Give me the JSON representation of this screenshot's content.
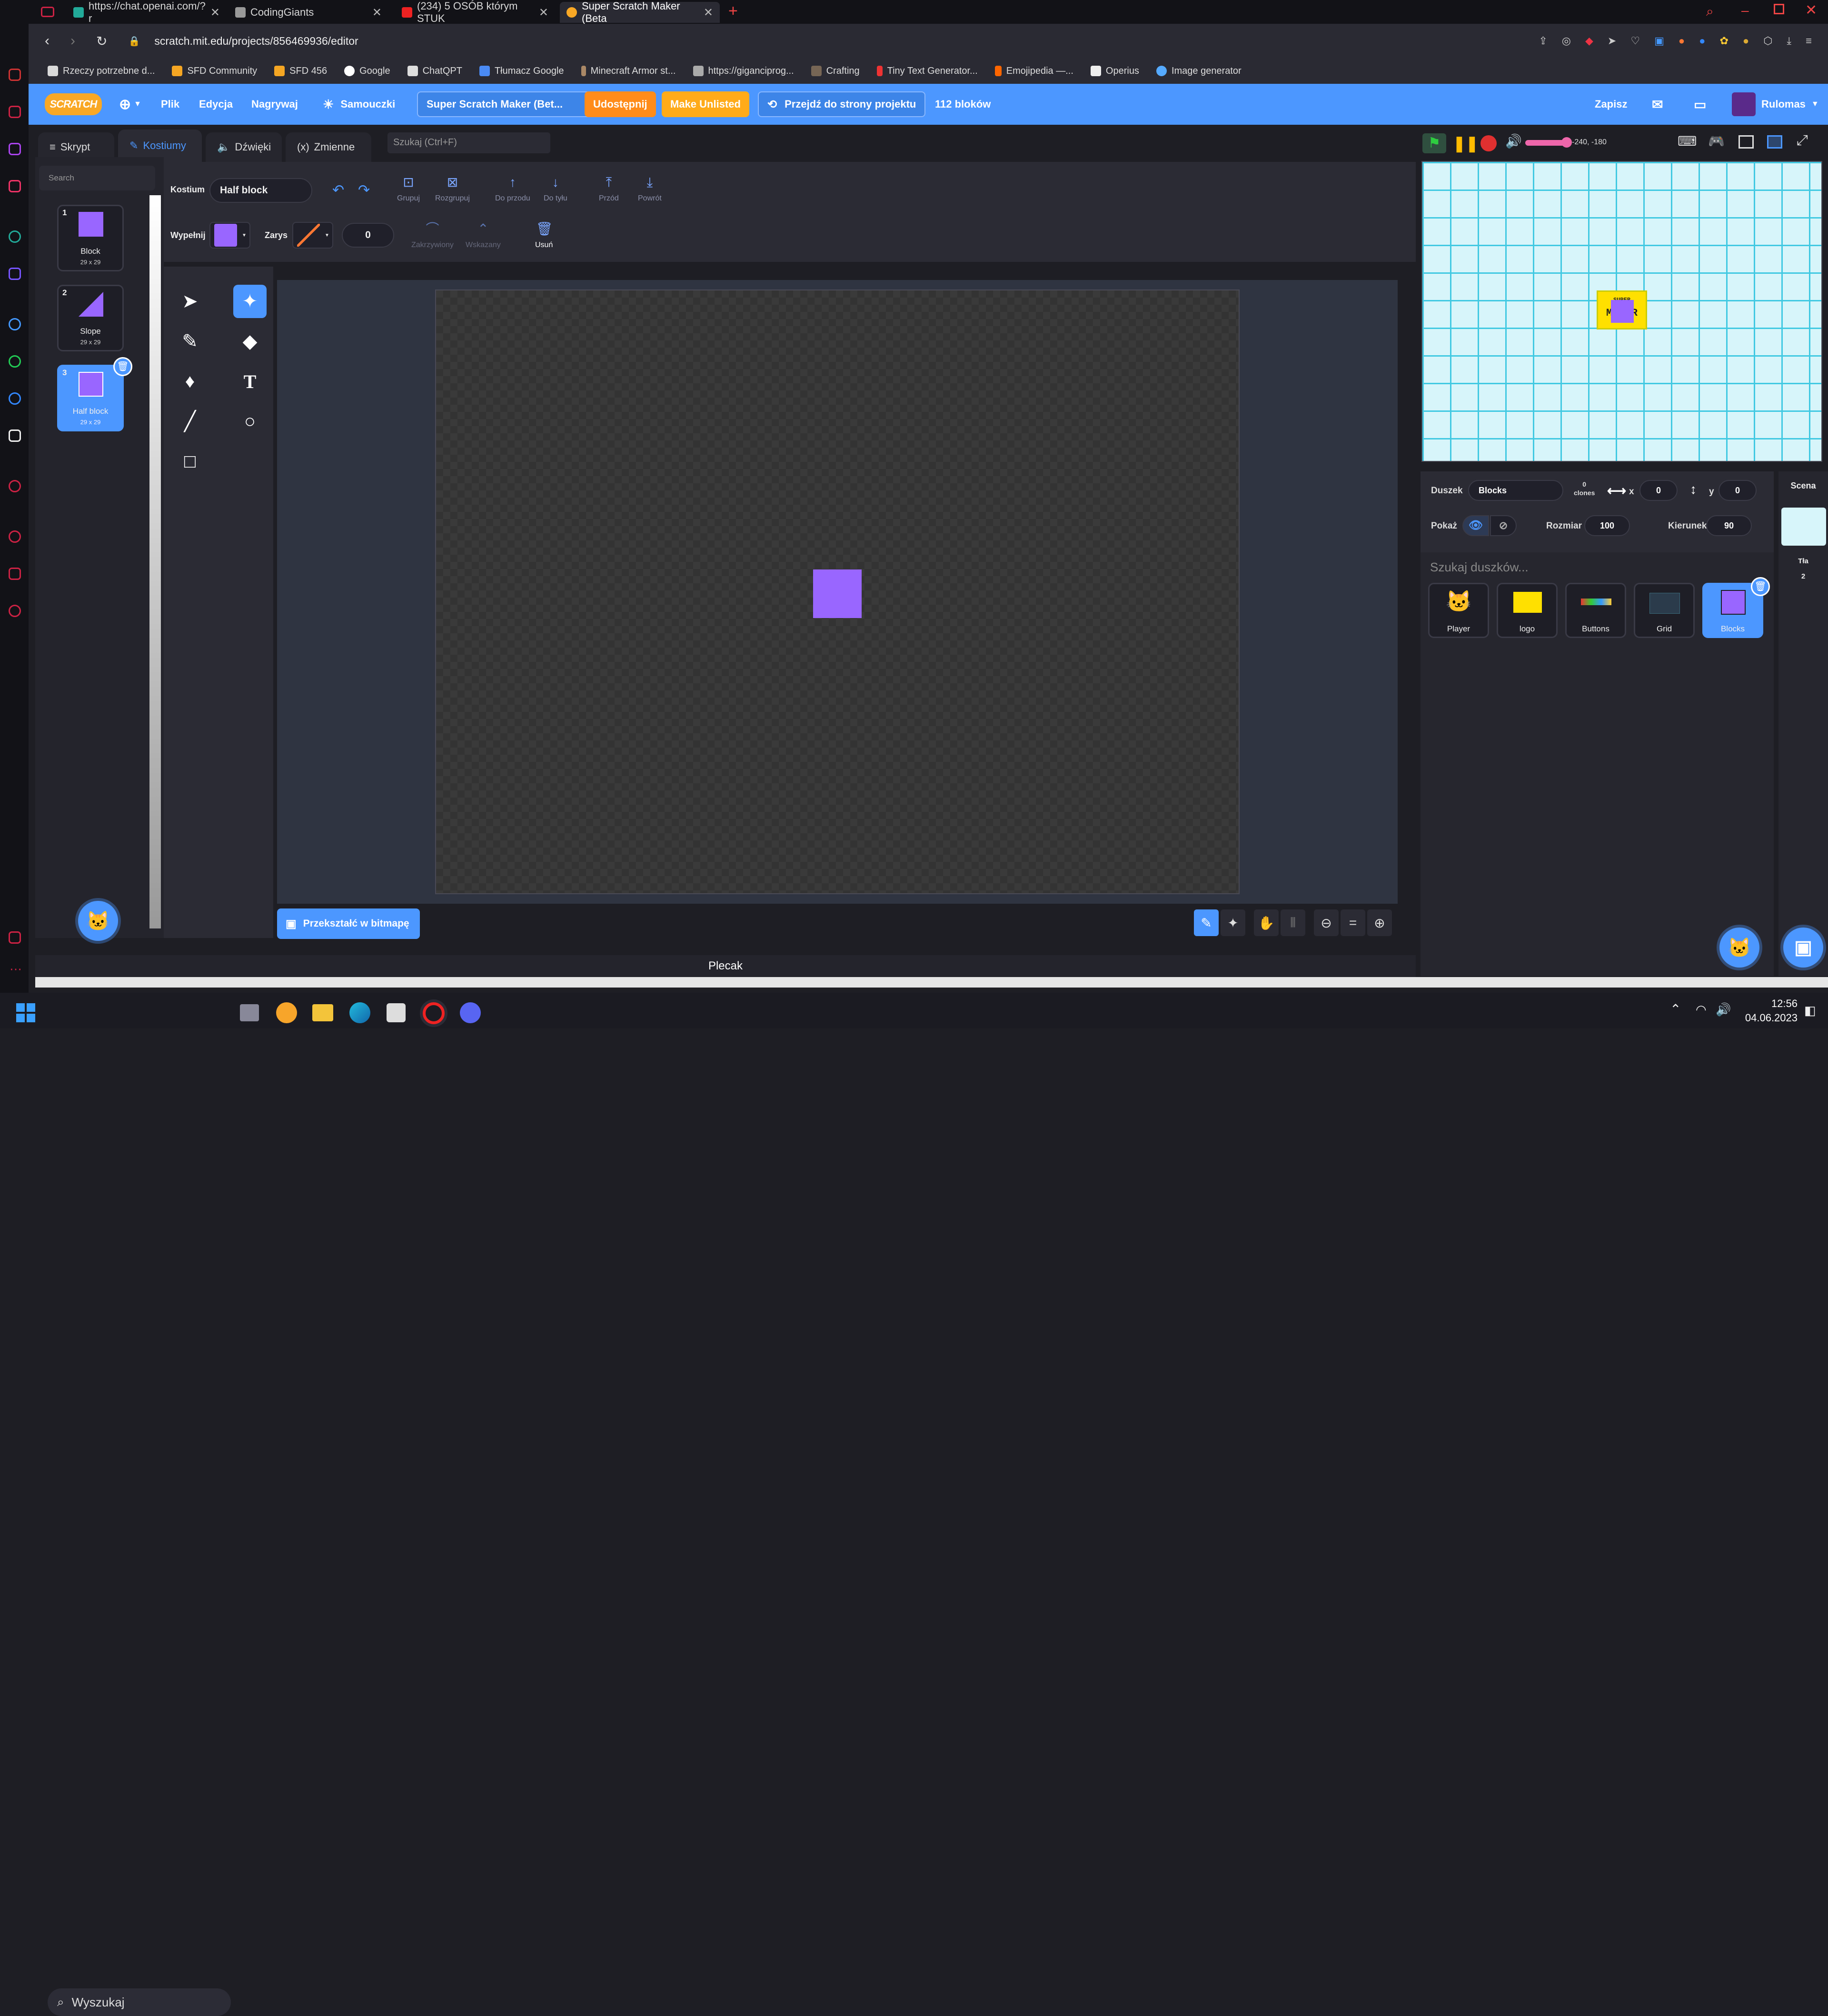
{
  "browser": {
    "tabs": [
      {
        "title": "https://chat.openai.com/?r",
        "icon": "openai-icon",
        "active": false
      },
      {
        "title": "CodingGiants",
        "icon": "page-icon",
        "active": false
      },
      {
        "title": "(234) 5 OSÓB którym STUK",
        "icon": "youtube-icon",
        "active": false
      },
      {
        "title": "Super Scratch Maker (Beta",
        "icon": "scratch-icon",
        "active": true
      }
    ],
    "address": "scratch.mit.edu/projects/856469936/editor",
    "bookmarks": [
      "Rzeczy potrzebne d...",
      "SFD Community",
      "SFD 456",
      "Google",
      "ChatQPT",
      "Tłumacz Google",
      "Minecraft Armor st...",
      "https://giganciprog...",
      "Crafting",
      "Tiny Text Generator...",
      "Emojipedia —...",
      "Operius",
      "Image generator"
    ]
  },
  "menubar": {
    "logo": "SCRATCH",
    "file": "Plik",
    "edit": "Edycja",
    "record": "Nagrywaj",
    "tutorials": "Samouczki",
    "project_title": "Super Scratch Maker (Bet...",
    "share": "Udostępnij",
    "unlisted": "Make Unlisted",
    "see_project": "Przejdź do strony projektu",
    "blocks_count": "112 bloków",
    "save": "Zapisz",
    "user": "Rulomas",
    "colors": {
      "bar": "#4c97ff",
      "share": "#ff8c1a",
      "unlisted": "#ffab19"
    }
  },
  "editor_tabs": {
    "code": "Skrypt",
    "costumes": "Kostiumy",
    "sounds": "Dźwięki",
    "variables": "Zmienne",
    "search_placeholder": "Szukaj (Ctrl+F)"
  },
  "costumes": {
    "search_placeholder": "Search",
    "items": [
      {
        "num": "1",
        "name": "Block",
        "dim": "29 x 29"
      },
      {
        "num": "2",
        "name": "Slope",
        "dim": "29 x 29"
      },
      {
        "num": "3",
        "name": "Half block",
        "dim": "29 x 29"
      }
    ]
  },
  "paint": {
    "costume_label": "Kostium",
    "costume_name": "Half block",
    "group": "Grupuj",
    "ungroup": "Rozgrupuj",
    "forward": "Do przodu",
    "backward": "Do tyłu",
    "front": "Przód",
    "back": "Powrót",
    "fill_label": "Wypełnij",
    "outline_label": "Zarys",
    "outline_width": "0",
    "curved": "Zakrzywiony",
    "pointed": "Wskazany",
    "delete": "Usuń",
    "fill_color": "#9966ff",
    "convert_bitmap": "Przekształć w bitmapę",
    "backpack": "Plecak"
  },
  "stage": {
    "mouse_xy": "-240, -180",
    "logo_line1": "SUPER",
    "logo_line2": "MAKER"
  },
  "sprite_info": {
    "sprite_label": "Duszek",
    "sprite_name": "Blocks",
    "clones_top": "0",
    "clones_bottom": "clones",
    "x_label": "x",
    "x": "0",
    "y_label": "y",
    "y": "0",
    "show_label": "Pokaż",
    "size_label": "Rozmiar",
    "size": "100",
    "direction_label": "Kierunek",
    "direction": "90",
    "search_placeholder": "Szukaj duszków...",
    "sprites": [
      "Player",
      "logo",
      "Buttons",
      "Grid",
      "Blocks"
    ]
  },
  "stage_panel": {
    "title": "Scena",
    "backdrops_label": "Tła",
    "backdrops_count": "2"
  },
  "taskbar": {
    "search": "Wyszukaj",
    "time": "12:56",
    "date": "04.06.2023"
  }
}
